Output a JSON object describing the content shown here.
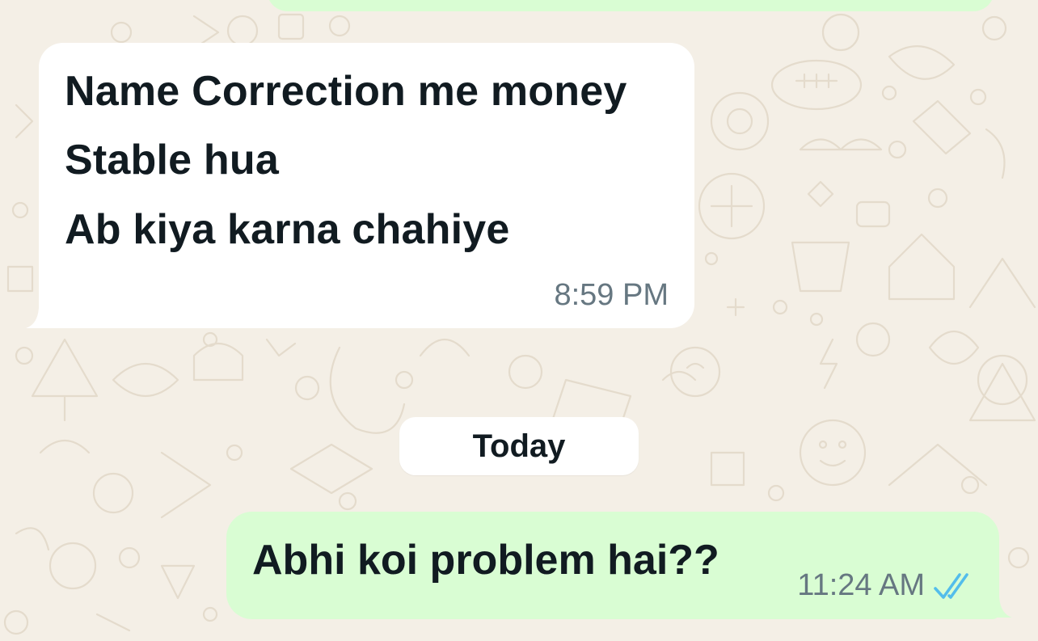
{
  "chat": {
    "incoming_message": {
      "lines": [
        "Name Correction me money",
        "Stable hua",
        "Ab kiya karna chahiye"
      ],
      "time": "8:59 PM"
    },
    "date_separator": "Today",
    "outgoing_message": {
      "text": "Abhi koi problem hai??",
      "time": "11:24 AM",
      "status_icon": "double-check-read-icon",
      "status_color": "#53bdeb"
    }
  },
  "colors": {
    "background": "#f4efe6",
    "incoming_bubble": "#ffffff",
    "outgoing_bubble": "#d9fdd3",
    "timestamp": "#667781"
  }
}
